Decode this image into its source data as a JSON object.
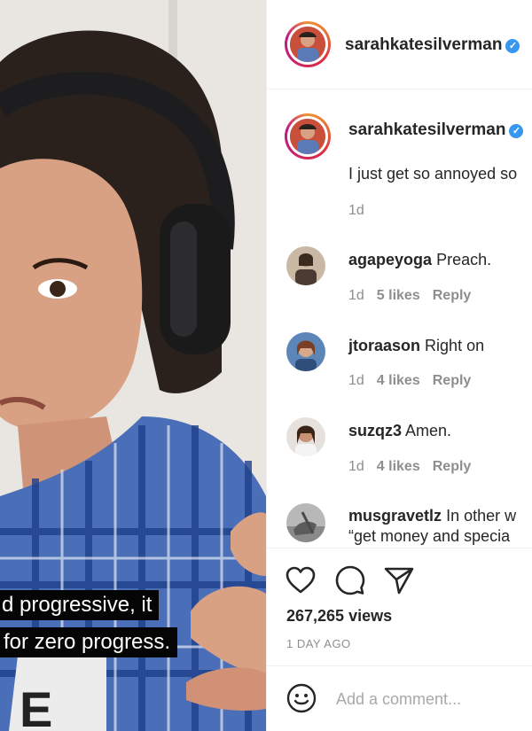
{
  "video": {
    "caption_line1": "d progressive, it",
    "caption_line2": "for zero progress."
  },
  "header": {
    "username": "sarahkatesilverman",
    "verified": true
  },
  "caption": {
    "username": "sarahkatesilverman",
    "text": "I just get so annoyed so",
    "time": "1d"
  },
  "comments": [
    {
      "username": "agapeyoga",
      "text": "Preach.",
      "time": "1d",
      "likes": "5 likes",
      "reply": "Reply"
    },
    {
      "username": "jtoraason",
      "text": "Right on",
      "time": "1d",
      "likes": "4 likes",
      "reply": "Reply"
    },
    {
      "username": "suzqz3",
      "text": "Amen.",
      "time": "1d",
      "likes": "4 likes",
      "reply": "Reply"
    },
    {
      "username": "musgravetlz",
      "text": "In other w",
      "text_line2": "“get money and specia"
    }
  ],
  "actions": {
    "like_icon": "heart-icon",
    "comment_icon": "comment-bubble-icon",
    "share_icon": "paper-plane-icon"
  },
  "stats": {
    "views": "267,265 views",
    "posted": "1 DAY AGO"
  },
  "add_comment": {
    "emoji_icon": "smiley-icon",
    "placeholder": "Add a comment..."
  },
  "colors": {
    "accent": "#3897f0",
    "secondary_text": "#8e8e8e",
    "primary_text": "#262626"
  }
}
